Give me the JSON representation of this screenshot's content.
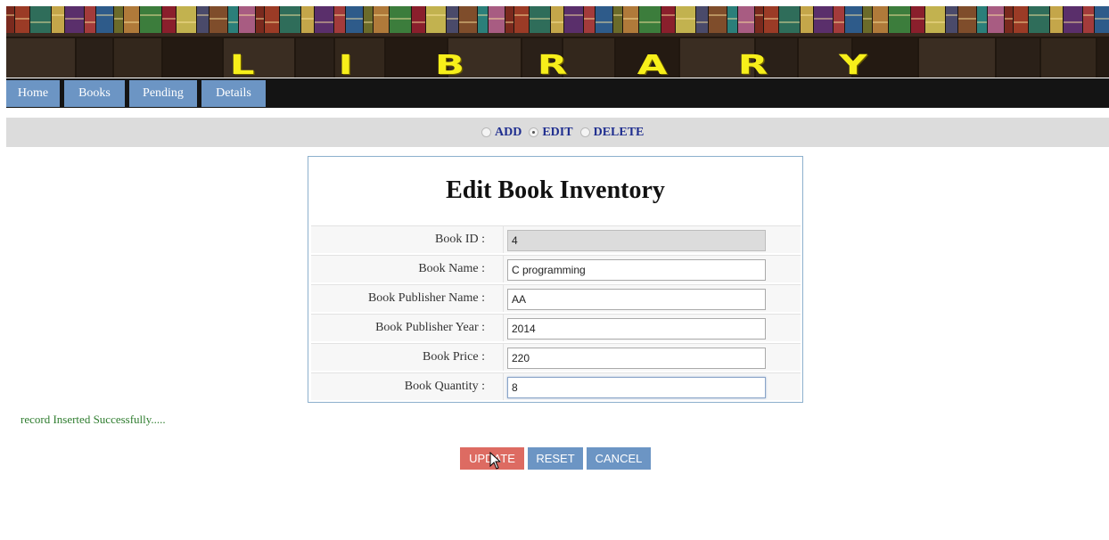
{
  "banner": {
    "letters": [
      "L",
      "I",
      "B",
      "R",
      "A",
      "R",
      "Y"
    ]
  },
  "nav": {
    "items": [
      {
        "label": "Home"
      },
      {
        "label": "Books"
      },
      {
        "label": "Pending"
      },
      {
        "label": "Details"
      }
    ]
  },
  "mode": {
    "options": [
      {
        "label": "ADD",
        "checked": false
      },
      {
        "label": "EDIT",
        "checked": true
      },
      {
        "label": "DELETE",
        "checked": false
      }
    ]
  },
  "form": {
    "title": "Edit Book Inventory",
    "fields": [
      {
        "label": "Book ID :",
        "value": "4",
        "readonly": true
      },
      {
        "label": "Book Name :",
        "value": "C programming"
      },
      {
        "label": "Book Publisher Name :",
        "value": "AA"
      },
      {
        "label": "Book Publisher Year :",
        "value": "2014"
      },
      {
        "label": "Book Price :",
        "value": "220"
      },
      {
        "label": "Book Quantity :",
        "value": "8",
        "focused": true
      }
    ]
  },
  "message": "record Inserted Successfully.....",
  "actions": {
    "update": "UPDATE",
    "reset": "RESET",
    "cancel": "CANCEL"
  },
  "colors": {
    "nav_button": "#6c95c4",
    "update_button": "#dd6b62",
    "banner_letters": "#f7ef1a",
    "success_text": "#2f7d2f",
    "mode_label": "#1f2e8f"
  }
}
